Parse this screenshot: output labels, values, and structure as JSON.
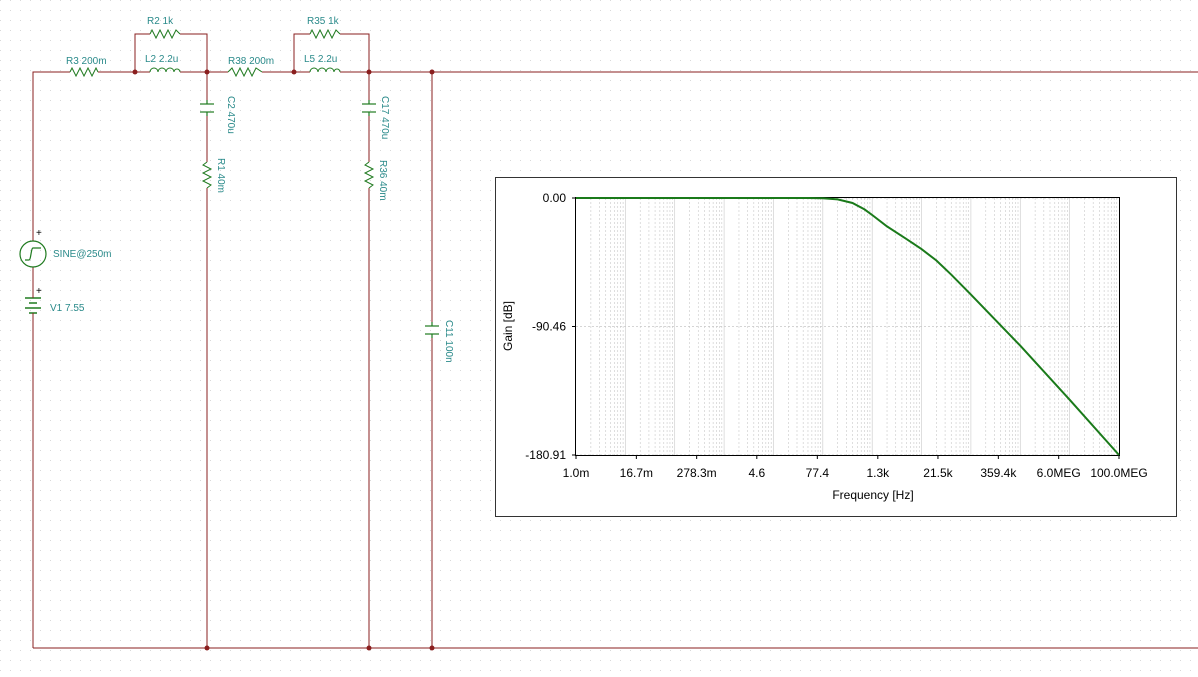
{
  "components": {
    "source": {
      "sine_label": "SINE@250m",
      "dc_label": "V1 7.55",
      "plus": "+"
    },
    "R3": "R3 200m",
    "R2": "R2 1k",
    "L2": "L2 2.2u",
    "R38": "R38 200m",
    "R35": "R35 1k",
    "L5": "L5 2.2u",
    "C2": "C2 470u",
    "R1": "R1 40m",
    "C17": "C17 470u",
    "R36": "R36 40m",
    "C11": "C11 100n"
  },
  "colors": {
    "wire": "#8a1f1f",
    "component": "#1f7a1f",
    "label": "#2a8a8a",
    "trace": "#1a7a1a",
    "grid_dot": "#d9d9d9"
  },
  "chart_data": {
    "type": "line",
    "title": "",
    "xlabel": "Frequency [Hz]",
    "ylabel": "Gain [dB]",
    "x_scale": "log",
    "x_ticks": [
      "1.0m",
      "16.7m",
      "278.3m",
      "4.6",
      "77.4",
      "1.3k",
      "21.5k",
      "359.4k",
      "6.0MEG",
      "100.0MEG"
    ],
    "x_tick_values": [
      0.001,
      0.0167,
      0.2783,
      4.6,
      77.4,
      1300,
      21500,
      359400,
      6000000,
      100000000
    ],
    "y_ticks": [
      "0.00",
      "-90.46",
      "-180.91"
    ],
    "y_tick_values": [
      0,
      -90.46,
      -180.91
    ],
    "xlim": [
      0.001,
      100000000
    ],
    "ylim": [
      -180.91,
      0
    ],
    "grid": true,
    "series": [
      {
        "x": [
          0.001,
          0.01,
          0.1,
          1,
          10,
          50,
          100,
          200,
          400,
          700,
          1000,
          2000,
          5000,
          10000,
          20000,
          40000,
          100000,
          1000000,
          10000000,
          100000000
        ],
        "values": [
          0,
          0,
          0,
          0,
          0,
          0,
          -0.2,
          -1,
          -3.5,
          -8,
          -12,
          -20,
          -29,
          -36,
          -44,
          -54,
          -68,
          -104,
          -142,
          -180.91
        ]
      }
    ]
  }
}
